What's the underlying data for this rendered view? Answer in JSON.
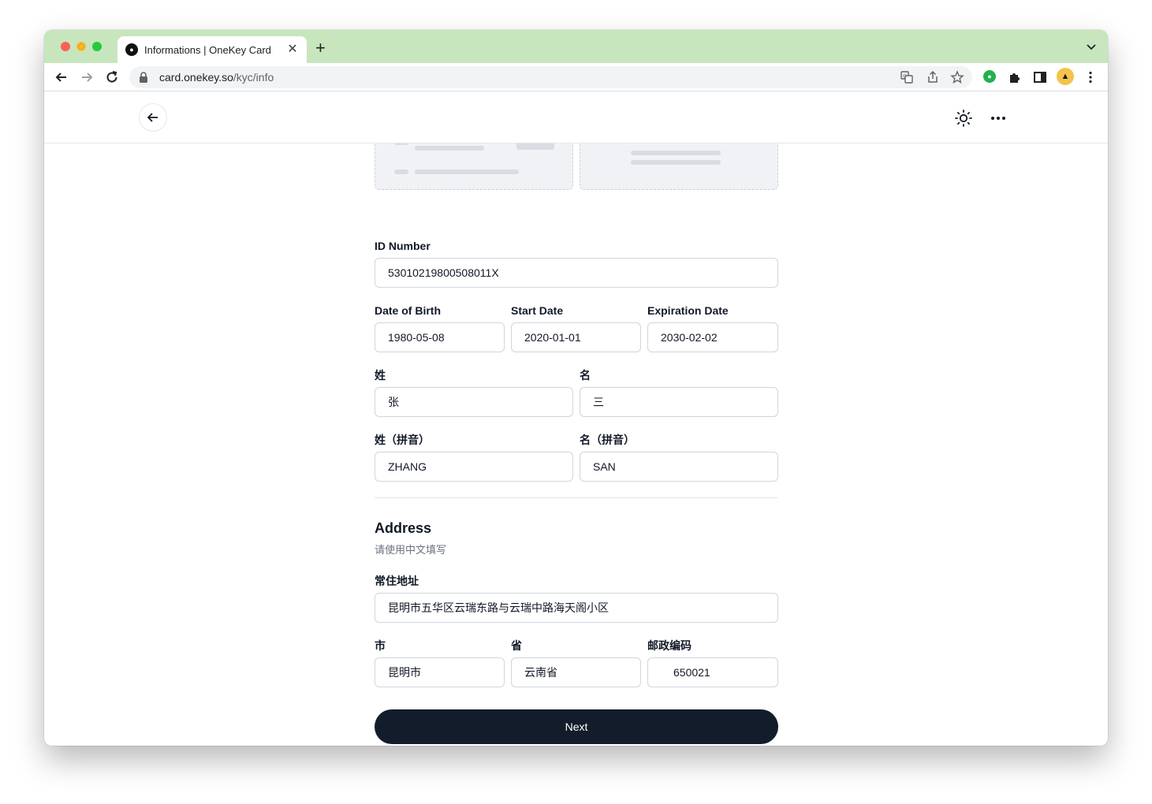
{
  "browser": {
    "tab_title": "Informations | OneKey Card",
    "url_host": "card.onekey.so",
    "url_path": "/kyc/info",
    "tab_close": "✕",
    "new_tab": "+"
  },
  "icons": {
    "back": "arrow-left-icon",
    "theme": "sun-icon",
    "more": "more-horizontal-icon"
  },
  "form": {
    "id_number": {
      "label": "ID Number",
      "value": "53010219800508011X"
    },
    "dob": {
      "label": "Date of Birth",
      "value": "1980-05-08"
    },
    "start_date": {
      "label": "Start Date",
      "value": "2020-01-01"
    },
    "expiration_date": {
      "label": "Expiration Date",
      "value": "2030-02-02"
    },
    "surname": {
      "label": "姓",
      "value": "张"
    },
    "given_name": {
      "label": "名",
      "value": "三"
    },
    "surname_pinyin": {
      "label": "姓（拼音）",
      "value": "ZHANG"
    },
    "given_name_pinyin": {
      "label": "名（拼音）",
      "value": "SAN"
    }
  },
  "address": {
    "title": "Address",
    "subtitle": "请使用中文填写",
    "residence": {
      "label": "常住地址",
      "value": "昆明市五华区云瑞东路与云瑞中路海天阁小区"
    },
    "city": {
      "label": "市",
      "value": "昆明市"
    },
    "province": {
      "label": "省",
      "value": "云南省"
    },
    "postal_code": {
      "label": "邮政编码",
      "value": "650021"
    }
  },
  "actions": {
    "next_label": "Next"
  },
  "colors": {
    "tabbar": "#c7e6bd",
    "primary_button": "#131c2b",
    "border": "#d1d5db"
  }
}
